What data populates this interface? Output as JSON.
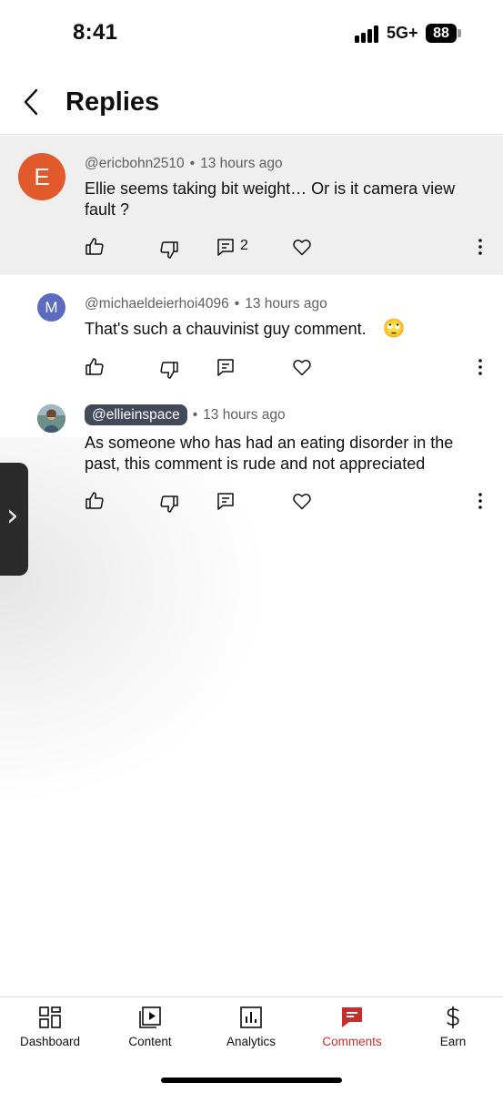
{
  "status_bar": {
    "time": "8:41",
    "network": "5G+",
    "battery": "88"
  },
  "header": {
    "title": "Replies"
  },
  "comments": [
    {
      "avatar_letter": "E",
      "avatar_color": "#e05a2b",
      "handle": "@ericbohn2510",
      "separator": "•",
      "time": "13 hours ago",
      "text": "Ellie seems taking bit weight… Or is it camera view fault ?",
      "reply_count": "2"
    },
    {
      "avatar_letter": "M",
      "avatar_color": "#5c6bc0",
      "handle": "@michaeldeierhoi4096",
      "separator": "•",
      "time": "13 hours ago",
      "text": "That's such a chauvinist guy comment.",
      "emoji": "🙄"
    },
    {
      "avatar_image": "profile-photo",
      "handle": "@ellieinspace",
      "separator": "•",
      "time": "13 hours ago",
      "text": "As someone who has had an eating disorder in the past, this comment is rude and not appreciated"
    }
  ],
  "bottom_nav": {
    "items": [
      {
        "label": "Dashboard",
        "icon": "dashboard-icon"
      },
      {
        "label": "Content",
        "icon": "content-icon"
      },
      {
        "label": "Analytics",
        "icon": "analytics-icon"
      },
      {
        "label": "Comments",
        "icon": "comments-icon",
        "active": true
      },
      {
        "label": "Earn",
        "icon": "dollar-icon"
      }
    ],
    "active_color": "#c4302b"
  }
}
